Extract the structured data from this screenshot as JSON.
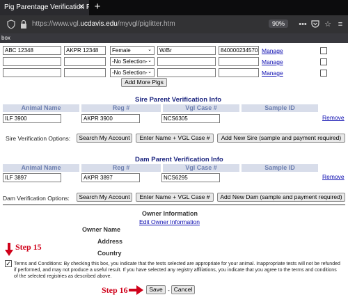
{
  "browser": {
    "tab_title": "Pig Parentage Verification Form",
    "tab_close": "✕",
    "new_tab": "+",
    "url_prefix": "https://www.vgl.",
    "url_domain": "ucdavis.edu",
    "url_path": "/myvgl/piglitter.htm",
    "zoom": "90%",
    "bookmark_text": "box"
  },
  "pigs": {
    "rows": [
      {
        "id": "ABC 12348",
        "reg": "AKPR 12348",
        "sex": "Female",
        "color": "W/Br",
        "tag": "840000234570",
        "manage": "Manage"
      },
      {
        "id": "",
        "reg": "",
        "sex": "-No Selection-",
        "color": "",
        "tag": "",
        "manage": "Manage"
      },
      {
        "id": "",
        "reg": "",
        "sex": "-No Selection-",
        "color": "",
        "tag": "",
        "manage": "Manage"
      }
    ],
    "add_more": "Add More Pigs"
  },
  "sire": {
    "title": "Sire Parent Verification Info",
    "columns": [
      "Animal Name",
      "Reg #",
      "Vgl Case #",
      "Sample ID"
    ],
    "row": {
      "name": "ILF 3900",
      "reg": "AKPR 3900",
      "case": "NCS6305",
      "remove": "Remove"
    },
    "options_label": "Sire Verification Options:",
    "buttons": [
      "Search My Account",
      "Enter Name + VGL Case #",
      "Add New Sire (sample and payment required)"
    ]
  },
  "dam": {
    "title": "Dam Parent Verification Info",
    "columns": [
      "Animal Name",
      "Reg #",
      "Vgl Case #",
      "Sample ID"
    ],
    "row": {
      "name": "ILF 3897",
      "reg": "AKPR 3897",
      "case": "NCS6295",
      "remove": "Remove"
    },
    "options_label": "Dam Verification Options:",
    "buttons": [
      "Search My Account",
      "Enter Name + VGL Case #",
      "Add New Dam (sample and payment required)"
    ]
  },
  "owner": {
    "title": "Owner Information",
    "edit_link": "Edit Owner Information",
    "fields": [
      "Owner Name",
      "Address",
      "Country"
    ]
  },
  "terms": {
    "text": "Terms and Conditions: By checking this box, you indicate that the tests selected are appropriate for your animal. Inappropriate tests will not be refunded if performed, and may not produce a useful result. If you have selected any registry affiliations, you indicate that you agree to the terms and conditions of the selected registries as described above."
  },
  "actions": {
    "save": "Save",
    "sep": "-",
    "cancel": "Cancel"
  },
  "annotations": {
    "step15": "Step 15",
    "step16": "Step 16",
    "color": "#d0021b"
  }
}
